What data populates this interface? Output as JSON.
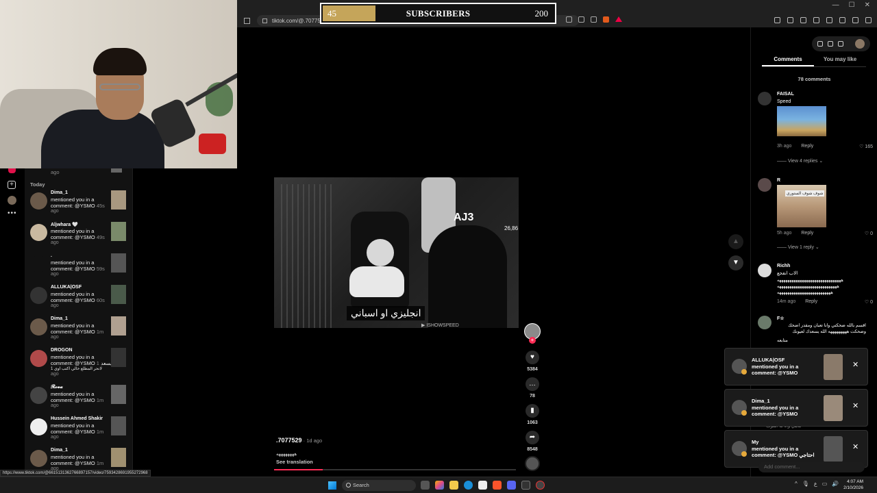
{
  "browser": {
    "url": "tiktok.com/@.7077529/video/7593428691955272968?is_from_webapp=1&sender_device=pc&web_id=22",
    "window_controls": [
      "—",
      "☐",
      "✕"
    ]
  },
  "subscriber_counter": {
    "current": "45",
    "label": "SUBSCRIBERS",
    "goal": "200",
    "progress_fraction": 0.225,
    "fill_color": "#c5a55a"
  },
  "rail": {
    "more": "•••",
    "plus": "+"
  },
  "inbox": {
    "previous_ago": "ago",
    "section_label": "Today",
    "notifications": [
      {
        "name": "Dima_1",
        "line1": "mentioned you in a",
        "line2": "comment: @YSMO",
        "time": "45s",
        "ago": "ago",
        "avatar_color": "#6b5a4a",
        "thumb_color": "#a89880"
      },
      {
        "name": "Aljwhara 🤍",
        "line1": "mentioned you in a",
        "line2": "comment: @YSMO",
        "time": "49s",
        "ago": "ago",
        "avatar_color": "#c9b9a0",
        "thumb_color": "#7a8a6a"
      },
      {
        "name": ".",
        "line1": "mentioned you in a",
        "line2": "comment: @YSMO",
        "time": "59s",
        "ago": "ago",
        "avatar_color": "#121212",
        "thumb_color": "#555"
      },
      {
        "name": "ALLUKA|OSF",
        "line1": "mentioned you in a",
        "line2": "comment: @YSMO",
        "time": "60s",
        "ago": "ago",
        "avatar_color": "#333",
        "thumb_color": "#4a5a4a"
      },
      {
        "name": "Dima_1",
        "line1": "mentioned you in a",
        "line2": "comment: @YSMO",
        "time": "1m",
        "ago": "ago",
        "avatar_color": "#6b5a4a",
        "thumb_color": "#b0a090"
      },
      {
        "name": "DROGON",
        "line1": "mentioned you in a",
        "line2": "comment: @YSMO يسعد",
        "line3": "لانحر المطلع خالي اكتب اوي 1",
        "time": "1m",
        "ago": "ago",
        "avatar_color": "#b04a4a",
        "thumb_color": "#333"
      },
      {
        "name": "𝓡𝓸𝓿𝓪",
        "line1": "mentioned you in a",
        "line2": "comment: @YSMO",
        "time": "1m",
        "ago": "ago",
        "avatar_color": "#444",
        "thumb_color": "#666"
      },
      {
        "name": "Hussein Ahmed Shakir",
        "line1": "mentioned you in a",
        "line2": "comment: @YSMO",
        "time": "1m",
        "ago": "ago",
        "avatar_color": "#eee",
        "thumb_color": "#555"
      },
      {
        "name": "Dima_1",
        "line1": "mentioned you in a",
        "line2": "comment: @YSMO",
        "time": "1m",
        "ago": "ago",
        "avatar_color": "#6b5a4a",
        "thumb_color": "#a09070"
      }
    ]
  },
  "status_url": "https://www.tiktok.com/@6615131362766897157/video/7593428691955272968",
  "video": {
    "overlay_text": "AJ3",
    "corner_number": "26,86",
    "caption": "انجليزي او اسباني",
    "watermark": "▶ ISHOWSPEED"
  },
  "actions": {
    "likes": "5384",
    "comments": "78",
    "saves": "1063",
    "shares": "8548",
    "follow": "+",
    "like_icon": "♥",
    "comment_icon": "…",
    "save_icon": "▮",
    "share_icon": "➦"
  },
  "video_meta": {
    "author": ".7077529",
    "date": " · 1d ago",
    "description": "ههههههههه",
    "see_translation": "See translation",
    "progress_fraction": 0.2,
    "progress_color": "#fe2c55"
  },
  "nav": {
    "up": "▲",
    "down": "▼"
  },
  "comments_panel": {
    "tabs": [
      "Comments",
      "You may like"
    ],
    "count": "78 comments",
    "comments": [
      {
        "name": "FAISAL",
        "text": "Speed",
        "time": "3h ago",
        "reply": "Reply",
        "likes": "165",
        "view_replies": "View 4 replies ⌄"
      },
      {
        "name": "R",
        "text": "",
        "time": "5h ago",
        "reply": "Reply",
        "likes": "0",
        "view_replies": "View 1 reply ⌄",
        "image_text": "شوف شوف الستوري"
      },
      {
        "name": "Richh",
        "text": "الاب انفجع",
        "text2": "هههههههههههههههههههههههههههههههه",
        "text3": "هههههههههههههههههههههههههههههه",
        "text4": "ههههههههههههههههههههههههههه",
        "time": "14m ago",
        "reply": "Reply",
        "likes": "0"
      },
      {
        "name": "F☆",
        "text": "اقسم بالله ضحكتي وانا تعبان ومقدر اضحك وضحكت هههههههههه الله يسعدك لعيونك",
        "text2": "متابعه"
      }
    ]
  },
  "toasts": [
    {
      "name": "ALLUKA|OSF",
      "msg": "mentioned you in a comment: @YSMO",
      "close": "✕",
      "thumb_color": "#8a7a6a"
    },
    {
      "name": "Dima_1",
      "msg": "mentioned you in a comment: @YSMO",
      "close": "✕",
      "thumb_color": "#9a8a7a"
    },
    {
      "name": "My",
      "msg": "mentioned you in a comment: @YSMO احتاجي",
      "close": "✕",
      "thumb_color": "#555"
    }
  ],
  "partial_comment_text": "ماهي وانا ما اشوف",
  "comment_input_placeholder": "Add comment...",
  "taskbar": {
    "search_label": "Search",
    "time": "4:07 AM",
    "date": "2/10/2026",
    "tray": [
      "^",
      "🎙",
      "ع",
      "▭",
      "🔊"
    ]
  }
}
